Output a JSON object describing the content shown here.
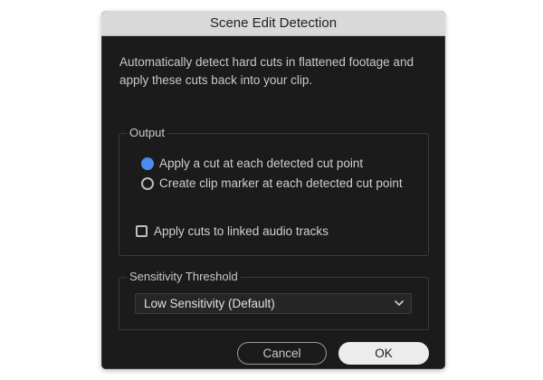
{
  "dialog": {
    "title": "Scene Edit Detection",
    "description": "Automatically detect hard cuts in flattened footage and apply these cuts back into your clip."
  },
  "output": {
    "label": "Output",
    "options": [
      {
        "label": "Apply a cut at each detected cut point",
        "selected": true
      },
      {
        "label": "Create clip marker at each detected cut point",
        "selected": false
      }
    ],
    "checkbox": {
      "label": "Apply cuts to linked audio tracks",
      "checked": false
    }
  },
  "sensitivity": {
    "label": "Sensitivity Threshold",
    "selected_value": "Low Sensitivity (Default)"
  },
  "buttons": {
    "cancel_label": "Cancel",
    "ok_label": "OK"
  },
  "colors": {
    "accent": "#4a8df0",
    "dialog_bg": "#1b1b1b",
    "titlebar_bg": "#d9d9d9"
  }
}
